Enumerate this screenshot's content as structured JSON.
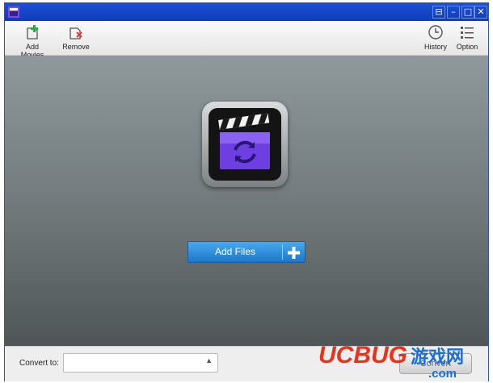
{
  "toolbar": {
    "add_movies": "Add Movies",
    "remove": "Remove",
    "history": "History",
    "option": "Option"
  },
  "main": {
    "add_files": "Add Files",
    "add_files_icon": "plus-icon"
  },
  "bottom": {
    "convert_to_label": "Convert to:",
    "convert_to_value": "",
    "convert_button": "Convert"
  },
  "watermark": {
    "brand": "UCBUG",
    "chinese": "游戏网",
    "domain": ".com"
  },
  "colors": {
    "title_bar": "#1648cc",
    "accent_blue": "#2b8fe0",
    "logo_purple": "#6d3fe0",
    "watermark_red": "#e8331c",
    "watermark_blue": "#1a6fd6"
  }
}
